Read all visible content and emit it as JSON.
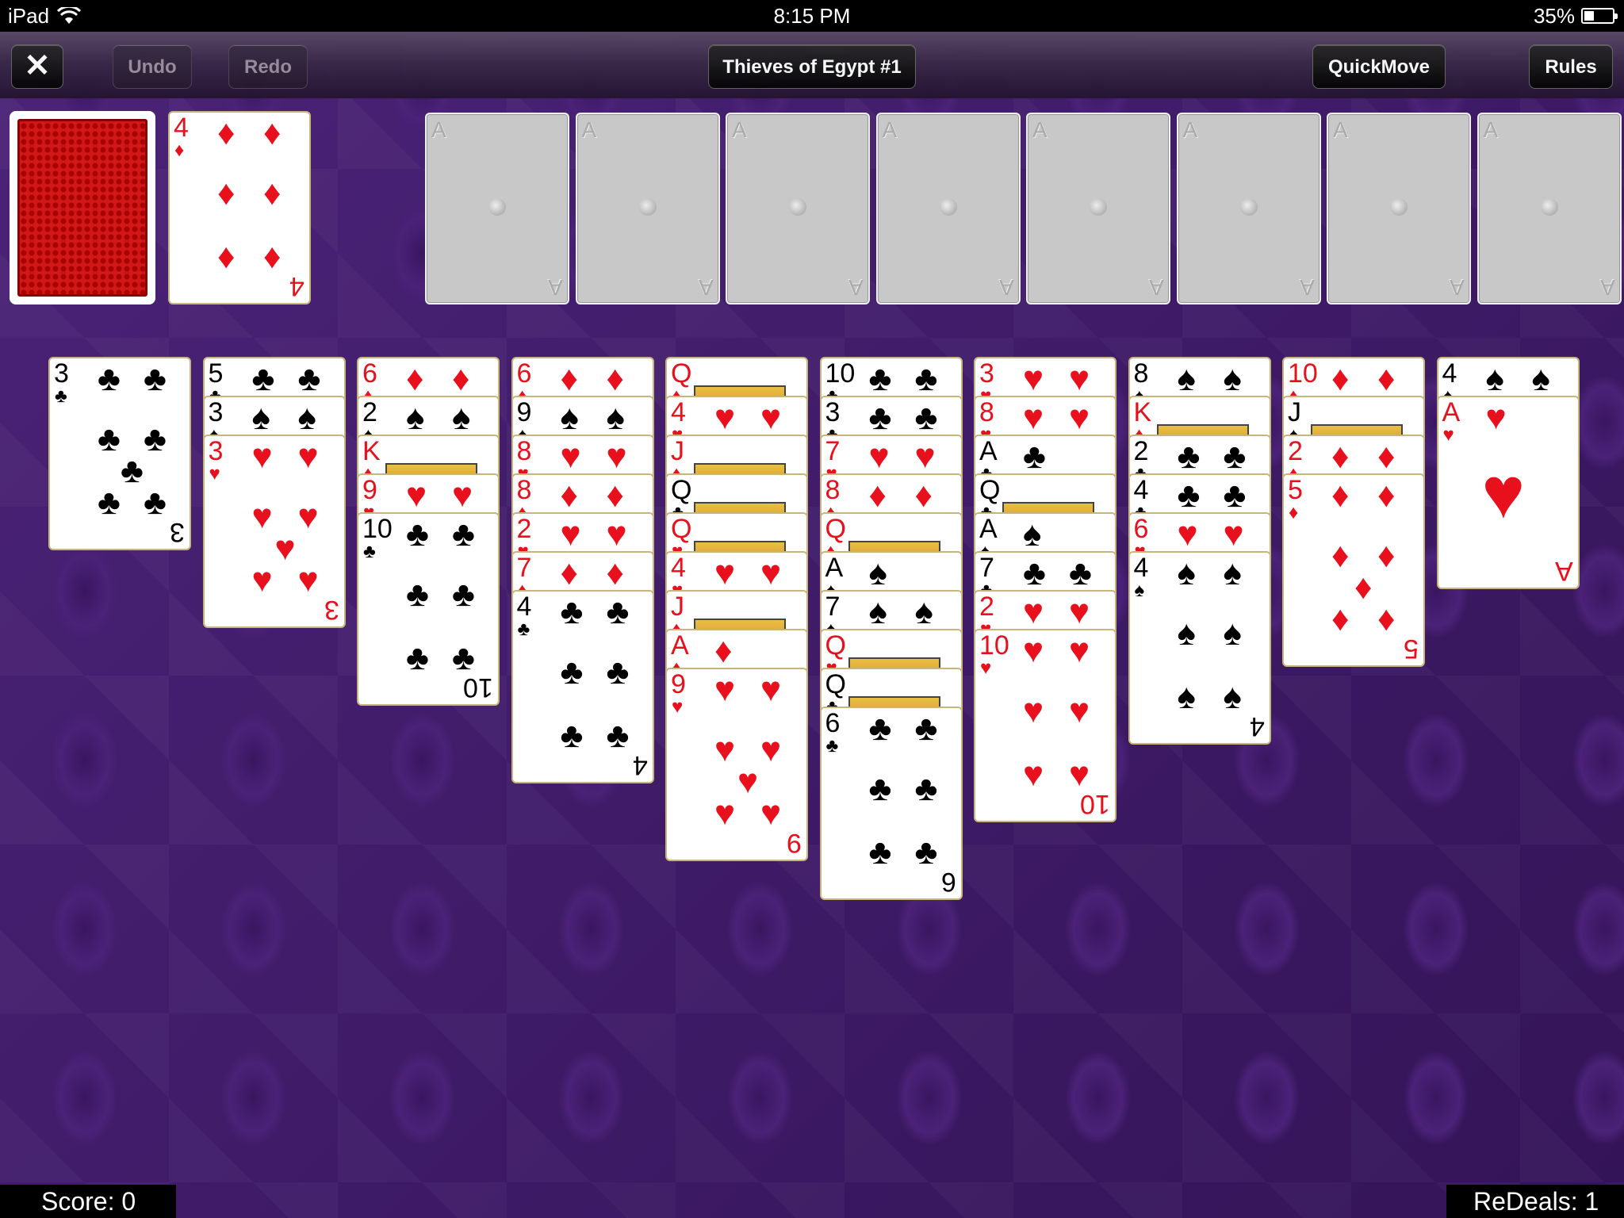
{
  "status_bar": {
    "device": "iPad",
    "time": "8:15 PM",
    "battery": "35%",
    "battery_level": 0.35
  },
  "toolbar": {
    "close_label": "✕",
    "undo_label": "Undo",
    "redo_label": "Redo",
    "title": "Thieves of Egypt #1",
    "quickmove_label": "QuickMove",
    "rules_label": "Rules"
  },
  "waste_card": {
    "rank": "4",
    "suit": "♦",
    "color": "red"
  },
  "foundation_label": "A",
  "columns": [
    [
      {
        "r": "3",
        "s": "♣"
      }
    ],
    [
      {
        "r": "5",
        "s": "♣"
      },
      {
        "r": "3",
        "s": "♠"
      },
      {
        "r": "3",
        "s": "♥"
      }
    ],
    [
      {
        "r": "6",
        "s": "♦"
      },
      {
        "r": "2",
        "s": "♠"
      },
      {
        "r": "K",
        "s": "♦"
      },
      {
        "r": "9",
        "s": "♥"
      },
      {
        "r": "10",
        "s": "♣"
      }
    ],
    [
      {
        "r": "6",
        "s": "♦"
      },
      {
        "r": "9",
        "s": "♠"
      },
      {
        "r": "8",
        "s": "♥"
      },
      {
        "r": "8",
        "s": "♦"
      },
      {
        "r": "2",
        "s": "♥"
      },
      {
        "r": "7",
        "s": "♦"
      },
      {
        "r": "4",
        "s": "♣"
      }
    ],
    [
      {
        "r": "Q",
        "s": "♦"
      },
      {
        "r": "4",
        "s": "♥"
      },
      {
        "r": "J",
        "s": "♦"
      },
      {
        "r": "Q",
        "s": "♣"
      },
      {
        "r": "Q",
        "s": "♥"
      },
      {
        "r": "4",
        "s": "♥"
      },
      {
        "r": "J",
        "s": "♦"
      },
      {
        "r": "A",
        "s": "♦"
      },
      {
        "r": "9",
        "s": "♥"
      }
    ],
    [
      {
        "r": "10",
        "s": "♣"
      },
      {
        "r": "3",
        "s": "♣"
      },
      {
        "r": "7",
        "s": "♥"
      },
      {
        "r": "8",
        "s": "♦"
      },
      {
        "r": "Q",
        "s": "♦"
      },
      {
        "r": "A",
        "s": "♠"
      },
      {
        "r": "7",
        "s": "♠"
      },
      {
        "r": "Q",
        "s": "♥"
      },
      {
        "r": "Q",
        "s": "♣"
      },
      {
        "r": "6",
        "s": "♣"
      }
    ],
    [
      {
        "r": "3",
        "s": "♥"
      },
      {
        "r": "8",
        "s": "♥"
      },
      {
        "r": "A",
        "s": "♣"
      },
      {
        "r": "Q",
        "s": "♣"
      },
      {
        "r": "A",
        "s": "♠"
      },
      {
        "r": "7",
        "s": "♣"
      },
      {
        "r": "2",
        "s": "♥"
      },
      {
        "r": "10",
        "s": "♥"
      }
    ],
    [
      {
        "r": "8",
        "s": "♠"
      },
      {
        "r": "K",
        "s": "♦"
      },
      {
        "r": "2",
        "s": "♣"
      },
      {
        "r": "4",
        "s": "♣"
      },
      {
        "r": "6",
        "s": "♥"
      },
      {
        "r": "4",
        "s": "♠"
      }
    ],
    [
      {
        "r": "10",
        "s": "♦"
      },
      {
        "r": "J",
        "s": "♠"
      },
      {
        "r": "2",
        "s": "♦"
      },
      {
        "r": "5",
        "s": "♦"
      }
    ],
    [
      {
        "r": "4",
        "s": "♠"
      },
      {
        "r": "A",
        "s": "♥"
      }
    ]
  ],
  "score_text": "Score: 0",
  "redeals_text": "ReDeals: 1",
  "colors": {
    "felt": "#3f1d63",
    "red_suit": "#e8101c",
    "card_border": "#c9b57a"
  }
}
